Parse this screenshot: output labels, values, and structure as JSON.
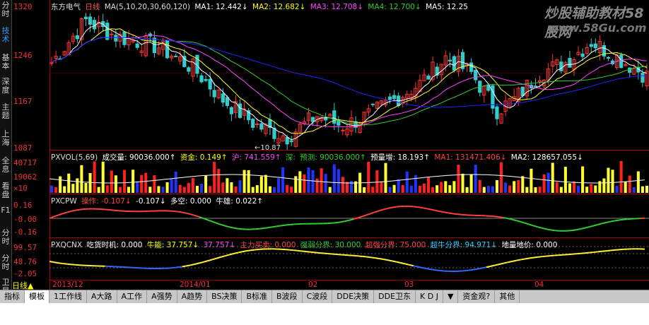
{
  "sidebar_tabs": [
    "分时",
    "技术",
    "基本",
    "深度",
    "主题",
    "上海",
    "全息",
    "看盘",
    "F1",
    "分时",
    "分时",
    "卫星"
  ],
  "active_sidebar_tab": 1,
  "axis": {
    "main": [
      "1320",
      "1246",
      "1167",
      "1087"
    ],
    "vol": [
      "40717",
      "19062",
      "×10"
    ],
    "pxcpw": [
      "0.16",
      "-0.00",
      "-0.16"
    ],
    "pxqcnx": [
      "99.57",
      "48.76",
      "-2.05"
    ]
  },
  "main_header": {
    "stock": "东方电气",
    "period": "日线",
    "ma_params": "MA(5,10,20,30,60,120)",
    "ma1": "MA1: 12.442↓",
    "ma2": "MA2: 12.682↓",
    "ma3": "MA3: 12.708↓",
    "ma4": "MA4: 12.700↓",
    "ma5": "MA5: 12.25"
  },
  "low_marker": "10.87",
  "vol_header": {
    "name": "PXVOL(5,69)",
    "vol": "成交量: 90036.000↑",
    "fund": "资金: 0.149↑",
    "hu": "沪: 741.559↑",
    "dk": "深:",
    "forecast": "预测: 90036.000↑",
    "forecast_inc": "预量增: 18.193↑",
    "ma1": "MA1: 131471.406↓",
    "ma2": "MA2: 128657.055↓"
  },
  "pxcpw_header": {
    "name": "PXCPW",
    "op": "操作: -0.107↓",
    "v2": "-0.107↓",
    "dk": "多空: 0.000",
    "ni": "牛雄: 0.022↑"
  },
  "pxqcnx_header": {
    "name": "PXQCNX",
    "t1": "吃货时机: 0.000",
    "t2": "牛能: 37.757↓",
    "t3": "37.757↓",
    "t4": "主力买卖: 0.000",
    "t5": "强弱分界: 30.000",
    "t6": "超强分界: 75.000",
    "t7": "超牛分界: 94.971↓",
    "t8": "地量地价: 0.000"
  },
  "period_label": "日线▲",
  "dates": [
    "2013/12",
    "2014/01",
    "02",
    "03",
    "04"
  ],
  "bottom_tabs": [
    "指标",
    "模板",
    "1工作线",
    "A大路",
    "A工作",
    "A强势",
    "A趋势",
    "BS决策",
    "B标准",
    "B波段",
    "C波段",
    "DDE决策",
    "DDE卫东",
    "K D J",
    "▼",
    "资金观?",
    "其他"
  ],
  "active_bottom_tab": 1,
  "watermark": "炒股辅助教材58股网",
  "watermark_url": "www.58Gu.com",
  "colors": {
    "up": "#ff3333",
    "down": "#33cccc",
    "ma5": "#ffffff",
    "ma10": "#ffff33",
    "ma20": "#ff44ff",
    "ma30": "#33cc33",
    "ma60": "#2222ff",
    "vol_up": "#ff2020",
    "vol_down": "#2233ff",
    "vol_yel": "#ffff33",
    "red": "#ff4040",
    "green": "#33cc33",
    "yellow": "#ffee33",
    "blue": "#3366ff"
  }
}
